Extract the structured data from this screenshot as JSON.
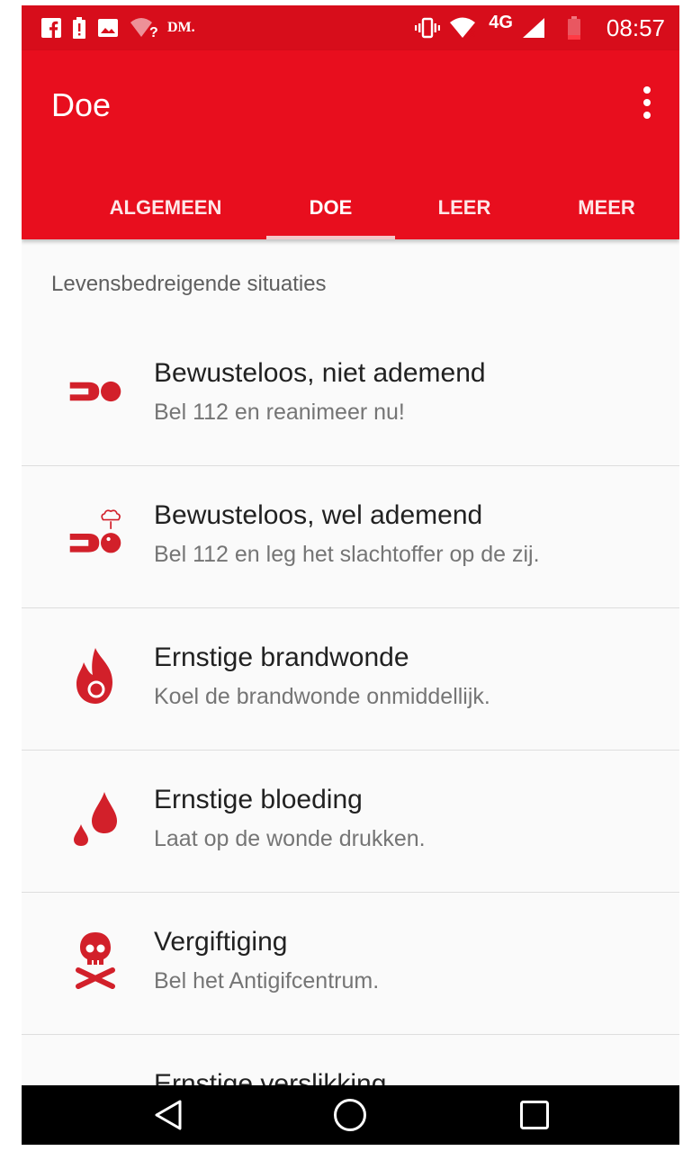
{
  "status_bar": {
    "carrier_text": "DM.",
    "network_label": "4G",
    "time": "08:57",
    "icons": [
      "facebook-icon",
      "alert-battery-icon",
      "image-icon",
      "wifi-question-icon",
      "vibrate-icon",
      "wifi-off-icon",
      "signal-icon",
      "battery-low-icon"
    ]
  },
  "app_bar": {
    "title": "Doe",
    "menu_icon": "more-vert-icon"
  },
  "tabs": [
    {
      "label": "ALGEMEEN",
      "active": false
    },
    {
      "label": "DOE",
      "active": true
    },
    {
      "label": "LEER",
      "active": false
    },
    {
      "label": "MEER",
      "active": false
    }
  ],
  "section": {
    "header": "Levensbedreigende situaties"
  },
  "items": [
    {
      "title": "Bewusteloos, niet ademend",
      "subtitle": "Bel 112 en reanimeer nu!",
      "icon": "unconscious-icon"
    },
    {
      "title": "Bewusteloos, wel ademend",
      "subtitle": "Bel 112 en leg het slachtoffer op de zij.",
      "icon": "recovery-position-icon"
    },
    {
      "title": "Ernstige brandwonde",
      "subtitle": "Koel de brandwonde onmiddellijk.",
      "icon": "flame-icon"
    },
    {
      "title": "Ernstige bloeding",
      "subtitle": "Laat op de wonde drukken.",
      "icon": "blood-drop-icon"
    },
    {
      "title": "Vergiftiging",
      "subtitle": "Bel het Antigifcentrum.",
      "icon": "skull-crossbones-icon"
    },
    {
      "title": "Ernstige verslikking",
      "subtitle": "",
      "icon": "choking-icon"
    }
  ],
  "nav_bar": [
    "back-icon",
    "home-icon",
    "recents-icon"
  ],
  "colors": {
    "primary": "#e80e1e",
    "status_bar": "#d70d1b",
    "icon_red": "#d2202a",
    "text_primary": "#212121",
    "text_secondary": "#757575"
  }
}
